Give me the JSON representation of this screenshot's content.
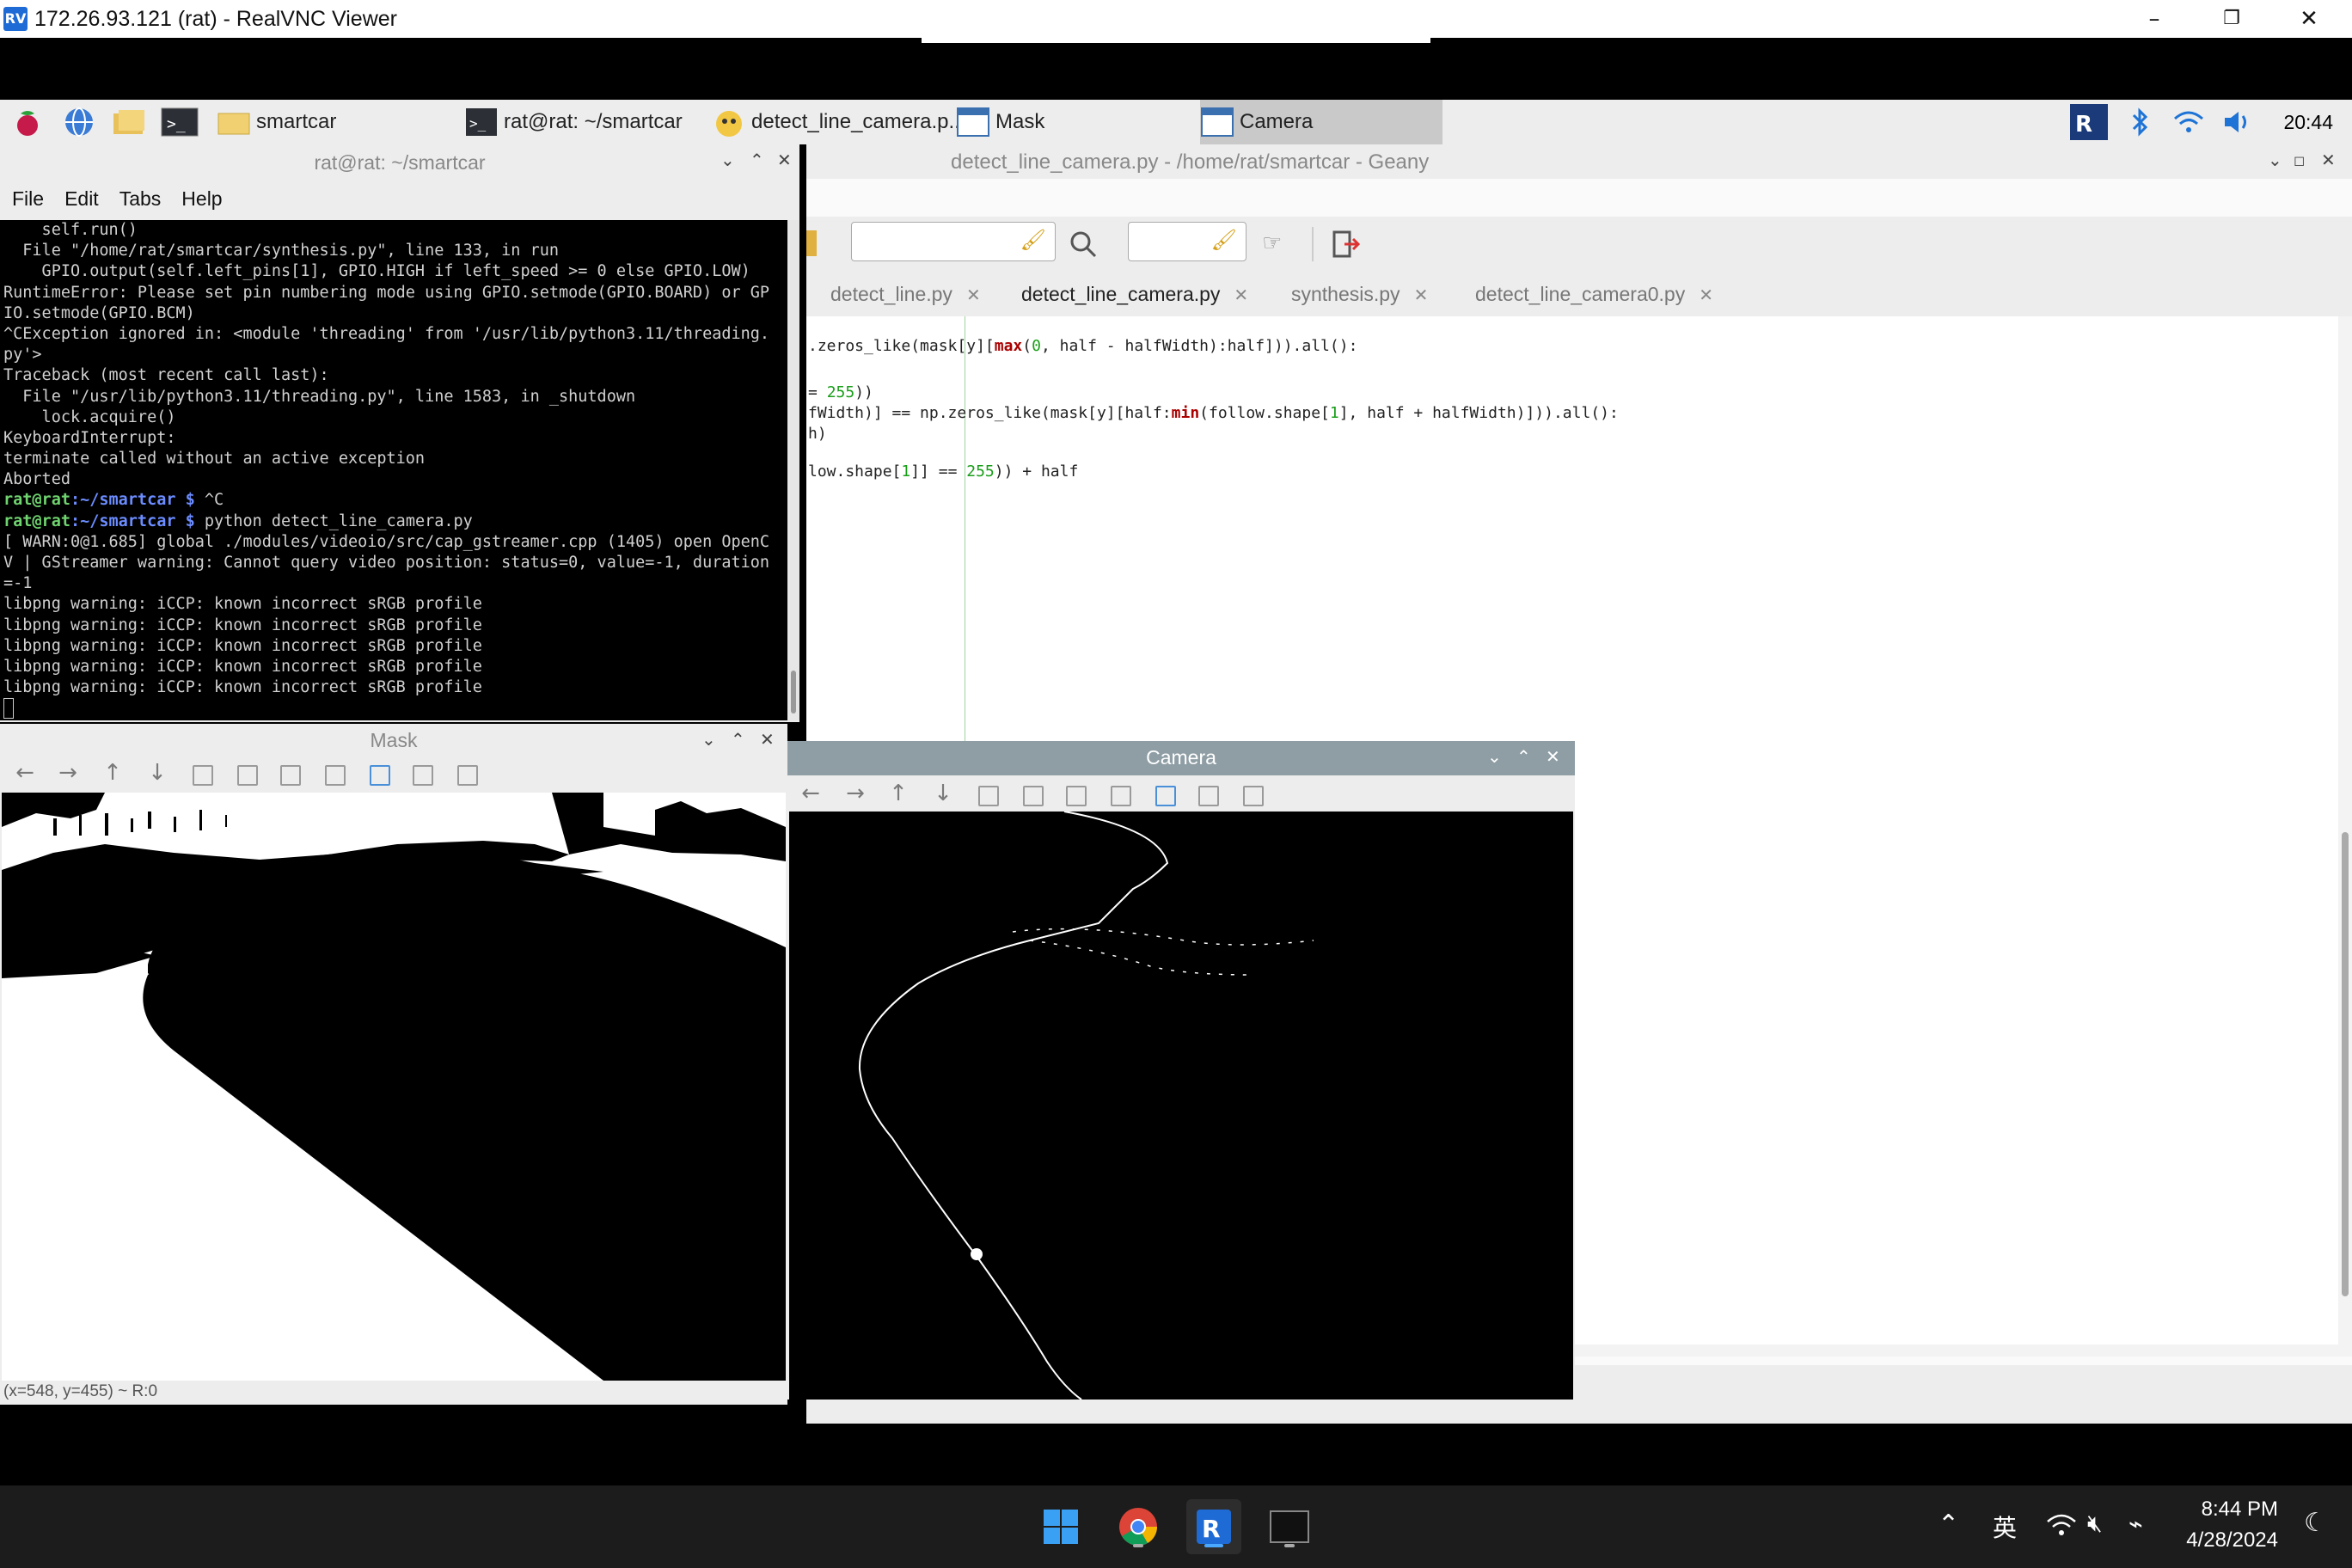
{
  "window": {
    "title": "172.26.93.121 (rat) - RealVNC Viewer",
    "logo": "RV",
    "minimize": "–",
    "restore": "❐",
    "close": "✕"
  },
  "pi_taskbar": {
    "items": [
      {
        "label": "smartcar"
      },
      {
        "label": "rat@rat: ~/smartcar"
      },
      {
        "label": "detect_line_camera.p..."
      },
      {
        "label": "Mask"
      },
      {
        "label": "Camera"
      }
    ],
    "clock": "20:44",
    "tray_icons": [
      "vnc-icon",
      "bluetooth-icon",
      "wifi-icon",
      "volume-icon"
    ]
  },
  "terminal": {
    "title": "rat@rat: ~/smartcar",
    "menu": [
      "File",
      "Edit",
      "Tabs",
      "Help"
    ],
    "lines": [
      "    self.run()",
      "  File \"/home/rat/smartcar/synthesis.py\", line 133, in run",
      "    GPIO.output(self.left_pins[1], GPIO.HIGH if left_speed >= 0 else GPIO.LOW)",
      "RuntimeError: Please set pin numbering mode using GPIO.setmode(GPIO.BOARD) or GP",
      "IO.setmode(GPIO.BCM)",
      "^CException ignored in: <module 'threading' from '/usr/lib/python3.11/threading.",
      "py'>",
      "Traceback (most recent call last):",
      "  File \"/usr/lib/python3.11/threading.py\", line 1583, in _shutdown",
      "    lock.acquire()",
      "KeyboardInterrupt:",
      "terminate called without an active exception",
      "Aborted"
    ],
    "prompt_user": "rat@rat",
    "prompt_path": ":~/smartcar",
    "prompt_symbol": " $ ",
    "cmd1": "^C",
    "cmd2": "python detect_line_camera.py",
    "lines2": [
      "[ WARN:0@1.685] global ./modules/videoio/src/cap_gstreamer.cpp (1405) open OpenC",
      "V | GStreamer warning: Cannot query video position: status=0, value=-1, duration",
      "=-1",
      "libpng warning: iCCP: known incorrect sRGB profile",
      "libpng warning: iCCP: known incorrect sRGB profile",
      "libpng warning: iCCP: known incorrect sRGB profile",
      "libpng warning: iCCP: known incorrect sRGB profile",
      "libpng warning: iCCP: known incorrect sRGB profile"
    ]
  },
  "geany": {
    "title": "detect_line_camera.py - /home/rat/smartcar - Geany",
    "tabs": [
      {
        "label": "detect_line.py",
        "close": "✕"
      },
      {
        "label": "detect_line_camera.py",
        "close": "✕"
      },
      {
        "label": "synthesis.py",
        "close": "✕"
      },
      {
        "label": "detect_line_camera0.py",
        "close": "✕"
      }
    ],
    "code": {
      "l1a": ".zeros_like(mask[y][",
      "l1kw": "max",
      "l1b": "(",
      "l1n": "0",
      "l1c": ", half - halfWidth):half])).all():",
      "l2a": "= ",
      "l2n": "255",
      "l2b": "))",
      "l3a": "fWidth)] == np.zeros_like(mask[y][half:",
      "l3kw": "min",
      "l3b": "(follow.shape[",
      "l3n": "1",
      "l3c": "], half + halfWidth)])).all():",
      "l4a": "h)",
      "l5a": "low.shape[",
      "l5n": "1",
      "l5b": "]] == ",
      "l5n2": "255",
      "l5c": ")) + half"
    }
  },
  "mask_window": {
    "title": "Mask",
    "status": "(x=548, y=455) ~ R:0"
  },
  "camera_window": {
    "title": "Camera"
  },
  "image_toolbar": [
    "←",
    "→",
    "↑",
    "↓"
  ],
  "win_taskbar": {
    "apps": [
      "start-icon",
      "chrome-icon",
      "realvnc-icon",
      "terminal-icon"
    ],
    "time": "8:44 PM",
    "date": "4/28/2024",
    "ime": "英"
  },
  "colors": {
    "camera_title_bg": "#8f9ea5",
    "prompt_green": "#6fd36f",
    "prompt_blue": "#6b8cff",
    "tab_underline": "#5d9dd2"
  }
}
